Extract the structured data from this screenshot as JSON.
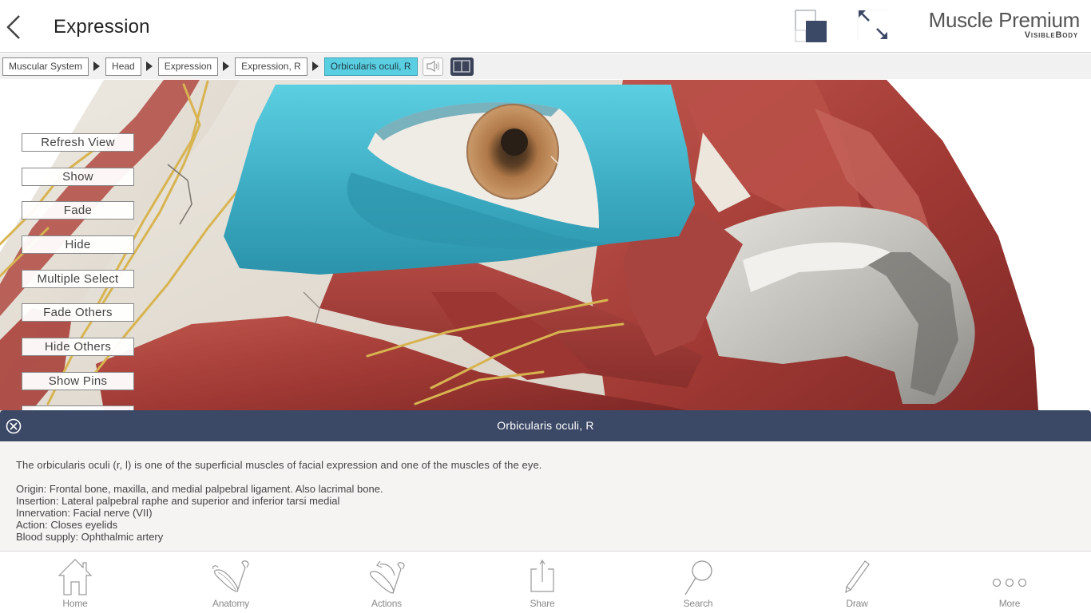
{
  "header": {
    "title": "Expression",
    "brand_title": "Muscle Premium",
    "brand_subtitle": "VisibleBody"
  },
  "breadcrumb": {
    "items": [
      {
        "label": "Muscular System",
        "active": false
      },
      {
        "label": "Head",
        "active": false
      },
      {
        "label": "Expression",
        "active": false
      },
      {
        "label": "Expression, R",
        "active": false
      },
      {
        "label": "Orbicularis oculi, R",
        "active": true
      }
    ]
  },
  "side_menu": {
    "items": [
      {
        "label": "Refresh View"
      },
      {
        "label": "Show"
      },
      {
        "label": "Fade"
      },
      {
        "label": "Hide"
      },
      {
        "label": "Multiple Select"
      },
      {
        "label": "Fade Others"
      },
      {
        "label": "Hide Others"
      },
      {
        "label": "Show Pins"
      }
    ]
  },
  "info_panel": {
    "title": "Orbicularis oculi, R",
    "description": "The orbicularis oculi (r, l) is one of the superficial muscles of facial expression and one of the muscles of the eye.",
    "details": [
      "Origin: Frontal bone, maxilla, and medial palpebral ligament. Also lacrimal bone.",
      "Insertion: Lateral palpebral raphe and superior and inferior tarsi medial",
      "Innervation: Facial nerve (VII)",
      "Action: Closes eyelids",
      "Blood supply: Ophthalmic artery"
    ]
  },
  "toolbar": {
    "items": [
      {
        "label": "Home",
        "icon": "home-icon"
      },
      {
        "label": "Anatomy",
        "icon": "anatomy-icon"
      },
      {
        "label": "Actions",
        "icon": "actions-icon"
      },
      {
        "label": "Share",
        "icon": "share-icon"
      },
      {
        "label": "Search",
        "icon": "search-icon"
      },
      {
        "label": "Draw",
        "icon": "draw-icon"
      },
      {
        "label": "More",
        "icon": "more-icon"
      }
    ]
  },
  "colors": {
    "selected_muscle": "#4fb8cc",
    "active_crumb": "#5bcfe2",
    "panel_header": "#3b4866",
    "muscle": "#a8403a",
    "bone": "#e6e0d6",
    "nerve": "#d8b450"
  }
}
